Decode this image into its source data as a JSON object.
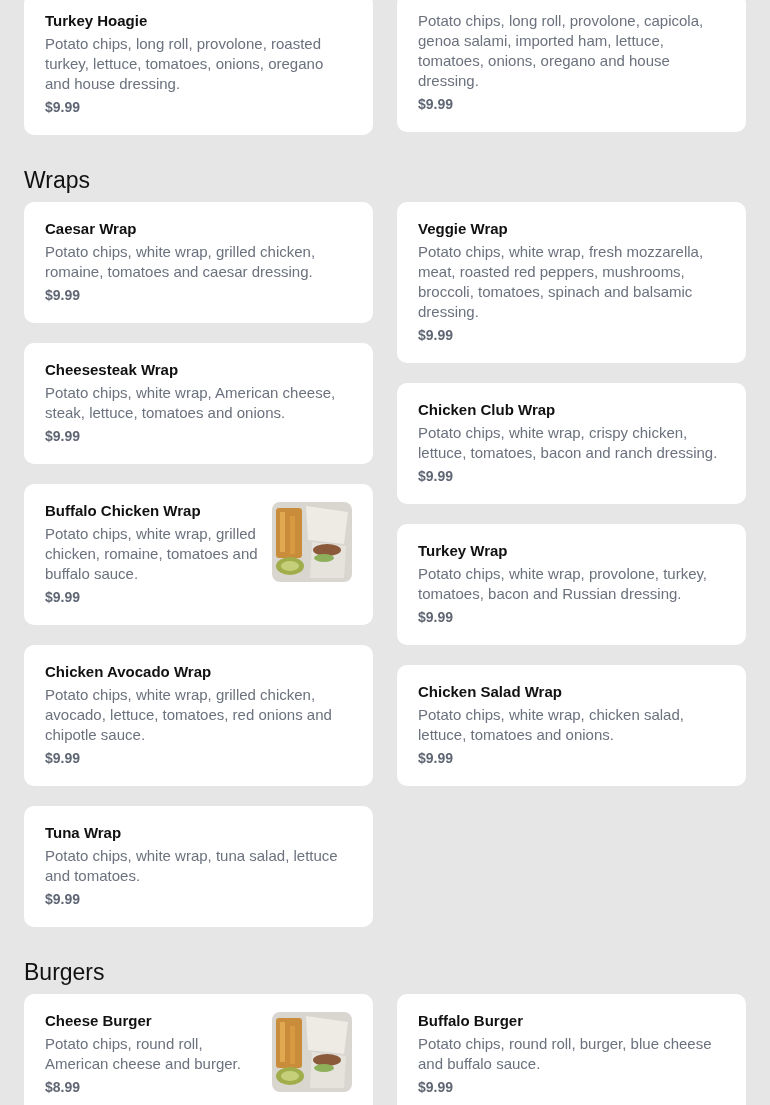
{
  "sections": [
    {
      "columns": [
        [
          {
            "name": "Turkey Hoagie",
            "description": "Potato chips, long roll, provolone, roasted turkey, lettuce, tomatoes, onions, oregano and house dressing.",
            "price": "$9.99"
          }
        ],
        [
          {
            "description": "Potato chips, long roll, provolone, capicola, genoa salami, imported ham, lettuce, tomatoes, onions, oregano and house dressing.",
            "price": "$9.99"
          }
        ]
      ]
    },
    {
      "title": "Wraps",
      "columns": [
        [
          {
            "name": "Caesar Wrap",
            "description": "Potato chips, white wrap, grilled chicken, romaine, tomatoes and caesar dressing.",
            "price": "$9.99"
          },
          {
            "name": "Cheesesteak Wrap",
            "description": "Potato chips, white wrap, American cheese, steak, lettuce, tomatoes and onions.",
            "price": "$9.99"
          },
          {
            "name": "Buffalo Chicken Wrap",
            "description": "Potato chips, white wrap, grilled chicken, romaine, tomatoes and buffalo sauce.",
            "price": "$9.99"
          },
          {
            "name": "Chicken Avocado Wrap",
            "description": "Potato chips, white wrap, grilled chicken, avocado, lettuce, tomatoes, red onions and chipotle sauce.",
            "price": "$9.99"
          },
          {
            "name": "Tuna Wrap",
            "description": "Potato chips, white wrap, tuna salad, lettuce and tomatoes.",
            "price": "$9.99"
          }
        ],
        [
          {
            "name": "Veggie Wrap",
            "description": "Potato chips, white wrap, fresh mozzarella, meat, roasted red peppers, mushrooms, broccoli, tomatoes, spinach and balsamic dressing.",
            "price": "$9.99"
          },
          {
            "name": "Chicken Club Wrap",
            "description": "Potato chips, white wrap, crispy chicken, lettuce, tomatoes, bacon and ranch dressing.",
            "price": "$9.99"
          },
          {
            "name": "Turkey Wrap",
            "description": "Potato chips, white wrap, provolone, turkey, tomatoes, bacon and Russian dressing.",
            "price": "$9.99"
          },
          {
            "name": "Chicken Salad Wrap",
            "description": "Potato chips, white wrap, chicken salad, lettuce, tomatoes and onions.",
            "price": "$9.99"
          }
        ]
      ]
    },
    {
      "title": "Burgers",
      "columns": [
        [
          {
            "name": "Cheese Burger",
            "description": "Potato chips, round roll, American cheese and burger.",
            "price": "$8.99"
          }
        ],
        [
          {
            "name": "Buffalo Burger",
            "description": "Potato chips, round roll, burger, blue cheese and buffalo sauce.",
            "price": "$9.99"
          }
        ]
      ]
    }
  ]
}
